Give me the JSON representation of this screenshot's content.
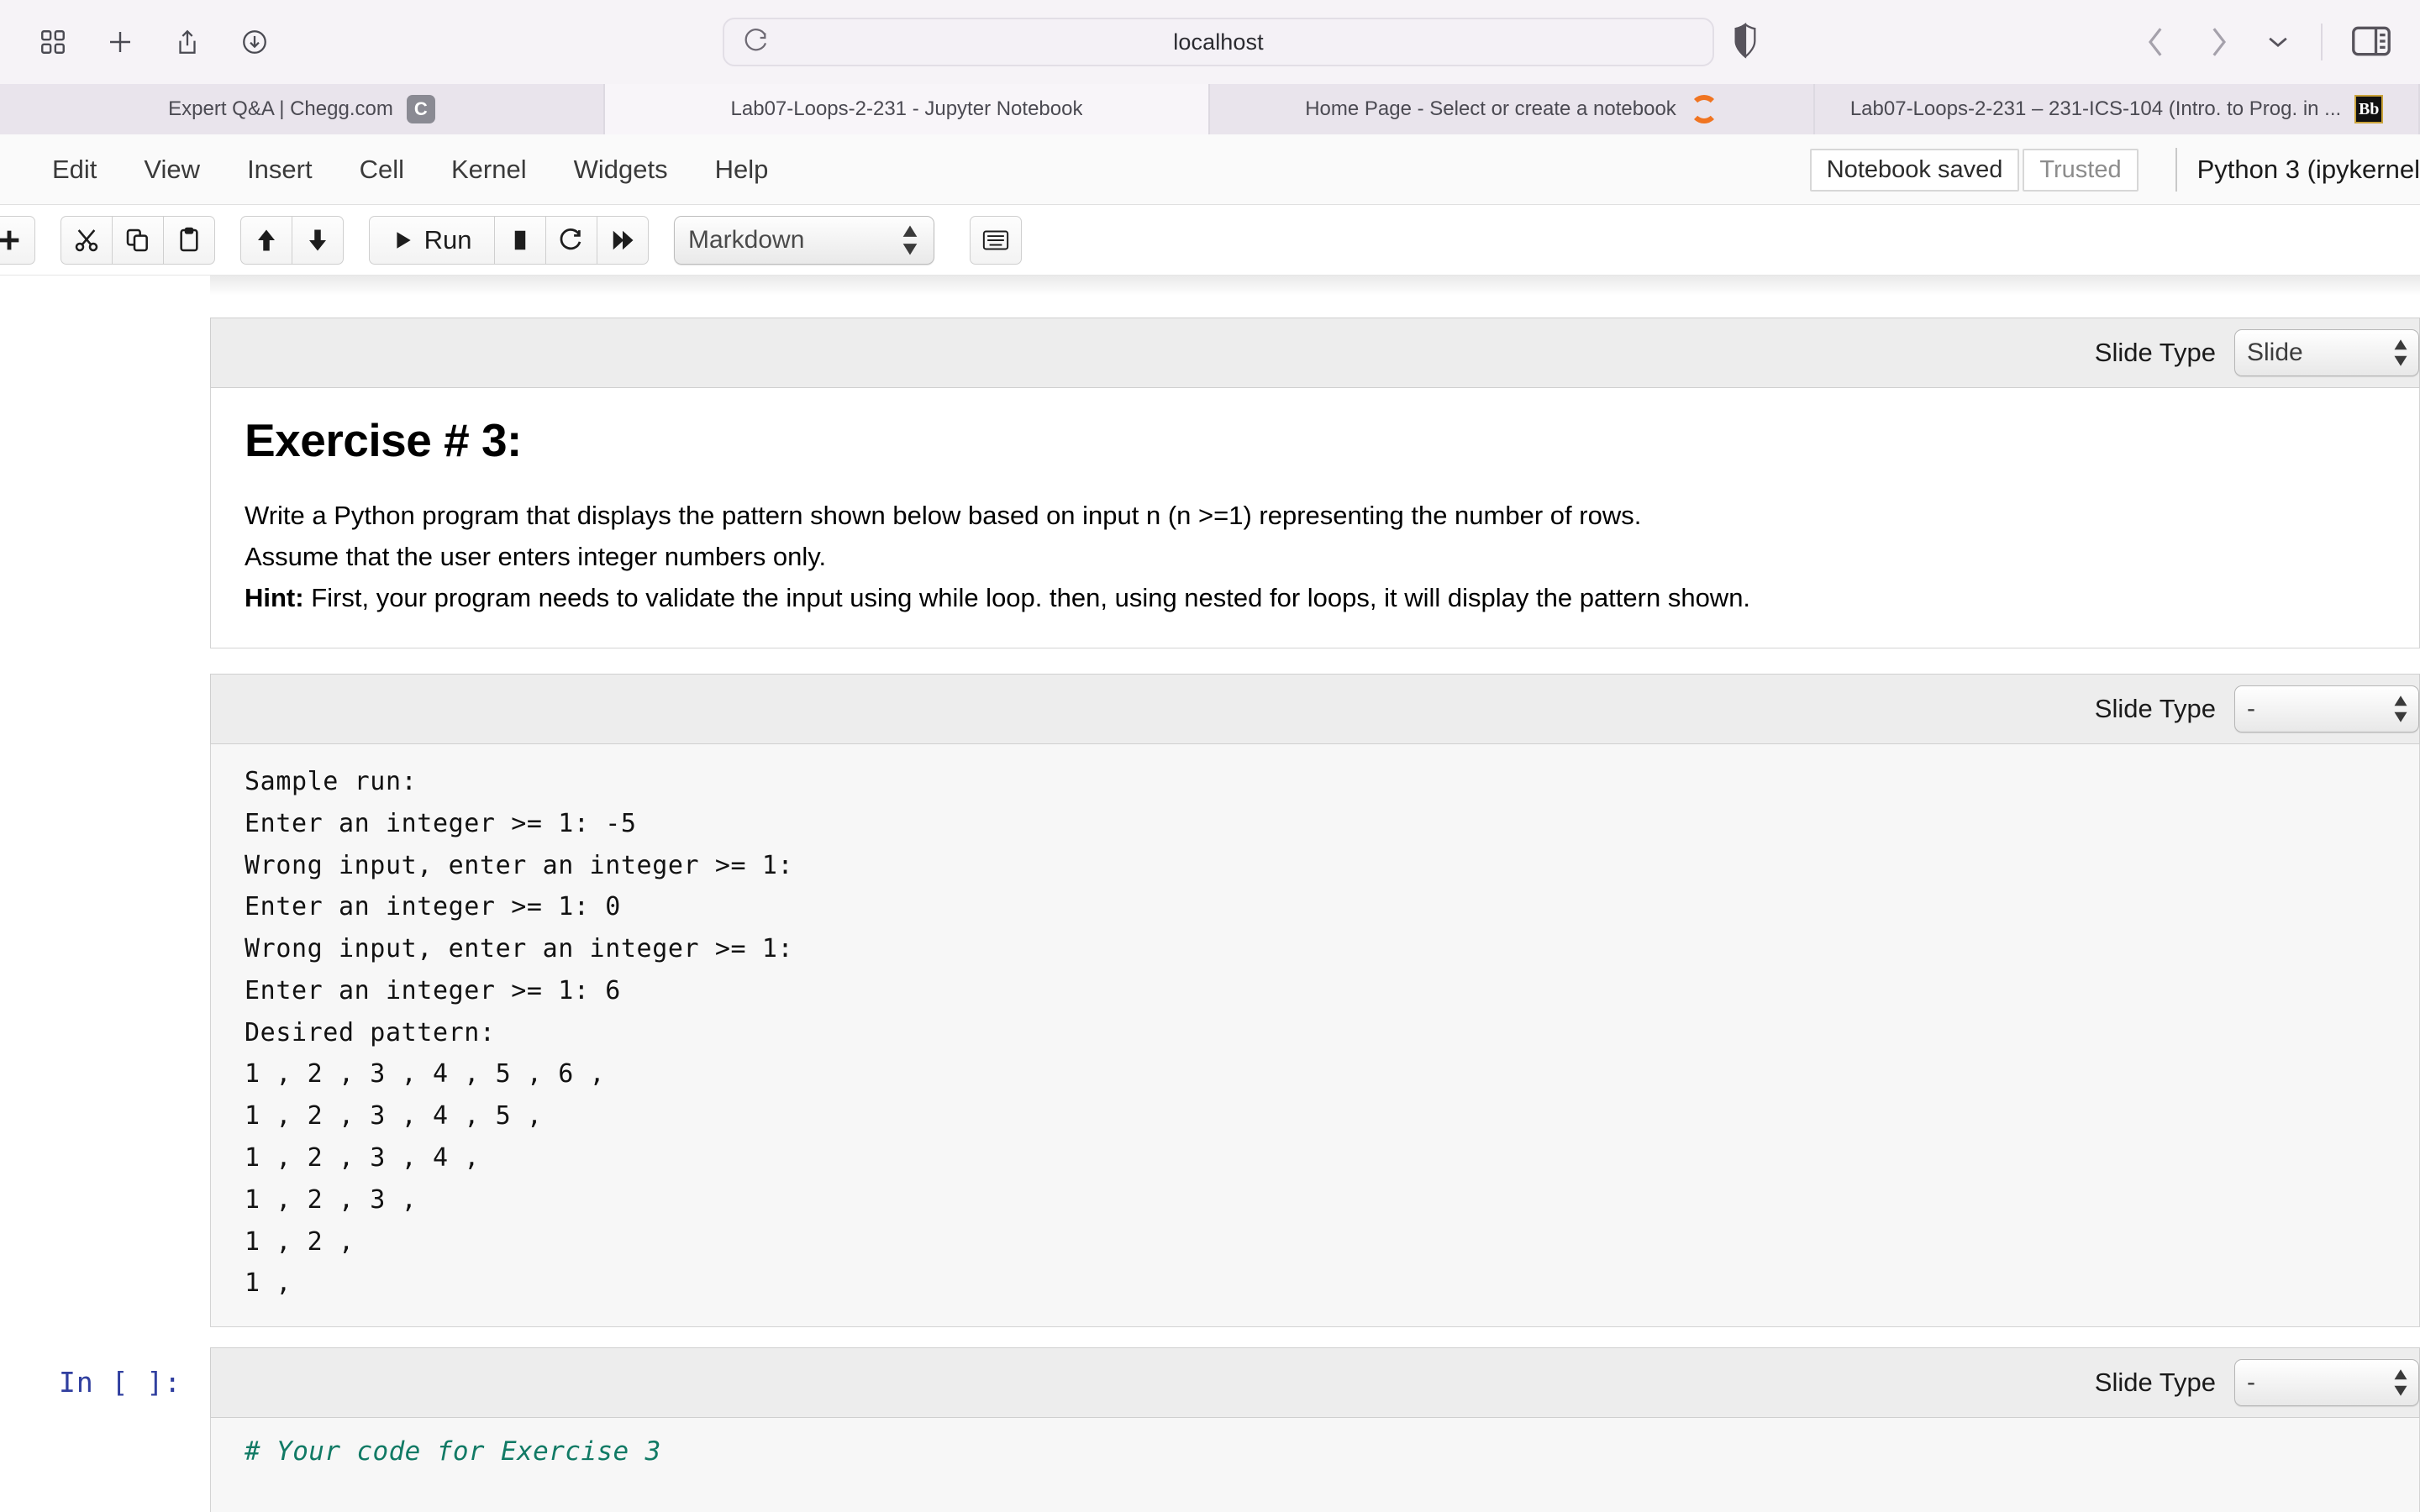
{
  "browser": {
    "url": "localhost",
    "icons": {
      "tab_overview": "grid-icon",
      "new_tab": "plus-icon",
      "share": "share-icon",
      "downloads": "download-icon",
      "reload": "reload-icon",
      "shield": "shield-icon",
      "back": "chevron-left-icon",
      "forward": "chevron-right-icon",
      "tab_menu": "chevron-down-icon",
      "sidebar": "sidebar-toggle-icon"
    },
    "tabs": [
      {
        "label": "Expert Q&A | Chegg.com",
        "favicon": "chegg-favicon",
        "favicon_text": "C",
        "active": false
      },
      {
        "label": "Lab07-Loops-2-231 - Jupyter Notebook",
        "favicon": "none",
        "favicon_text": "",
        "active": true
      },
      {
        "label": "Home Page - Select or create a notebook",
        "favicon": "loading-spinner-icon",
        "favicon_text": "",
        "active": false
      },
      {
        "label": "Lab07-Loops-2-231 – 231-ICS-104 (Intro. to Prog. in ...",
        "favicon": "blackboard-favicon",
        "favicon_text": "Bb",
        "active": false
      }
    ]
  },
  "jupyter": {
    "menus": [
      "Edit",
      "View",
      "Insert",
      "Cell",
      "Kernel",
      "Widgets",
      "Help"
    ],
    "status": {
      "saved_label": "Notebook saved",
      "trusted_label": "Trusted",
      "kernel_label": "Python 3 (ipykernel"
    },
    "toolbar": {
      "groups": [
        [
          {
            "name": "insert-cell-below-button",
            "icon": "plus-icon",
            "label": ""
          }
        ],
        [
          {
            "name": "cut-cell-button",
            "icon": "scissors-icon",
            "label": ""
          },
          {
            "name": "copy-cell-button",
            "icon": "copy-icon",
            "label": ""
          },
          {
            "name": "paste-cell-button",
            "icon": "paste-icon",
            "label": ""
          }
        ],
        [
          {
            "name": "move-cell-up-button",
            "icon": "arrow-up-icon",
            "label": ""
          },
          {
            "name": "move-cell-down-button",
            "icon": "arrow-down-icon",
            "label": ""
          }
        ],
        [
          {
            "name": "run-cell-button",
            "icon": "play-icon",
            "label": "Run"
          },
          {
            "name": "interrupt-kernel-button",
            "icon": "stop-square-icon",
            "label": ""
          },
          {
            "name": "restart-kernel-button",
            "icon": "restart-icon",
            "label": ""
          },
          {
            "name": "restart-and-run-all-button",
            "icon": "fast-forward-icon",
            "label": ""
          }
        ]
      ],
      "cell_type_value": "Markdown",
      "keyboard_shortcut_button": "keyboard-icon"
    }
  },
  "cells": [
    {
      "slide_type_label": "Slide Type",
      "slide_type_value": "Slide",
      "kind": "markdown",
      "heading": "Exercise # 3:",
      "paragraphs": [
        {
          "bold_prefix": "",
          "text": "Write a Python program that displays the pattern shown below based on input n (n >=1) representing the number of rows."
        },
        {
          "bold_prefix": "",
          "text": "Assume that the user enters integer numbers only."
        },
        {
          "bold_prefix": "Hint:",
          "text": " First, your program needs to validate the input using while loop. then, using nested for loops, it will display the pattern shown."
        }
      ]
    },
    {
      "slide_type_label": "Slide Type",
      "slide_type_value": "-",
      "kind": "code-output",
      "code": "Sample run:\nEnter an integer >= 1: -5\nWrong input, enter an integer >= 1:\nEnter an integer >= 1: 0\nWrong input, enter an integer >= 1:\nEnter an integer >= 1: 6\nDesired pattern:\n1 , 2 , 3 , 4 , 5 , 6 ,\n1 , 2 , 3 , 4 , 5 ,\n1 , 2 , 3 , 4 ,\n1 , 2 , 3 ,\n1 , 2 ,\n1 ,"
    },
    {
      "slide_type_label": "Slide Type",
      "slide_type_value": "-",
      "kind": "code-input",
      "prompt": "In [ ]:",
      "code": "# Your code for Exercise 3"
    }
  ]
}
